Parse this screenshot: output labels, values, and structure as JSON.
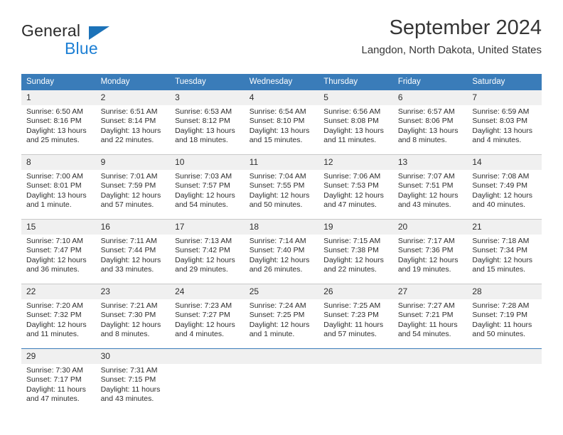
{
  "brand": {
    "name_dark": "General",
    "name_blue": "Blue",
    "triangle_color": "#1c72b8",
    "blue_color": "#1c7fd4"
  },
  "header": {
    "title": "September 2024",
    "location": "Langdon, North Dakota, United States"
  },
  "theme": {
    "header_bg": "#3a7cb9",
    "header_text": "#ffffff",
    "daynum_bg": "#f0f0f0",
    "grid_line": "#c9c9c9",
    "text": "#2d2d2d"
  },
  "weekdays": [
    "Sunday",
    "Monday",
    "Tuesday",
    "Wednesday",
    "Thursday",
    "Friday",
    "Saturday"
  ],
  "weeks": [
    [
      {
        "day": "1",
        "sunrise": "Sunrise: 6:50 AM",
        "sunset": "Sunset: 8:16 PM",
        "daylight1": "Daylight: 13 hours",
        "daylight2": "and 25 minutes."
      },
      {
        "day": "2",
        "sunrise": "Sunrise: 6:51 AM",
        "sunset": "Sunset: 8:14 PM",
        "daylight1": "Daylight: 13 hours",
        "daylight2": "and 22 minutes."
      },
      {
        "day": "3",
        "sunrise": "Sunrise: 6:53 AM",
        "sunset": "Sunset: 8:12 PM",
        "daylight1": "Daylight: 13 hours",
        "daylight2": "and 18 minutes."
      },
      {
        "day": "4",
        "sunrise": "Sunrise: 6:54 AM",
        "sunset": "Sunset: 8:10 PM",
        "daylight1": "Daylight: 13 hours",
        "daylight2": "and 15 minutes."
      },
      {
        "day": "5",
        "sunrise": "Sunrise: 6:56 AM",
        "sunset": "Sunset: 8:08 PM",
        "daylight1": "Daylight: 13 hours",
        "daylight2": "and 11 minutes."
      },
      {
        "day": "6",
        "sunrise": "Sunrise: 6:57 AM",
        "sunset": "Sunset: 8:06 PM",
        "daylight1": "Daylight: 13 hours",
        "daylight2": "and 8 minutes."
      },
      {
        "day": "7",
        "sunrise": "Sunrise: 6:59 AM",
        "sunset": "Sunset: 8:03 PM",
        "daylight1": "Daylight: 13 hours",
        "daylight2": "and 4 minutes."
      }
    ],
    [
      {
        "day": "8",
        "sunrise": "Sunrise: 7:00 AM",
        "sunset": "Sunset: 8:01 PM",
        "daylight1": "Daylight: 13 hours",
        "daylight2": "and 1 minute."
      },
      {
        "day": "9",
        "sunrise": "Sunrise: 7:01 AM",
        "sunset": "Sunset: 7:59 PM",
        "daylight1": "Daylight: 12 hours",
        "daylight2": "and 57 minutes."
      },
      {
        "day": "10",
        "sunrise": "Sunrise: 7:03 AM",
        "sunset": "Sunset: 7:57 PM",
        "daylight1": "Daylight: 12 hours",
        "daylight2": "and 54 minutes."
      },
      {
        "day": "11",
        "sunrise": "Sunrise: 7:04 AM",
        "sunset": "Sunset: 7:55 PM",
        "daylight1": "Daylight: 12 hours",
        "daylight2": "and 50 minutes."
      },
      {
        "day": "12",
        "sunrise": "Sunrise: 7:06 AM",
        "sunset": "Sunset: 7:53 PM",
        "daylight1": "Daylight: 12 hours",
        "daylight2": "and 47 minutes."
      },
      {
        "day": "13",
        "sunrise": "Sunrise: 7:07 AM",
        "sunset": "Sunset: 7:51 PM",
        "daylight1": "Daylight: 12 hours",
        "daylight2": "and 43 minutes."
      },
      {
        "day": "14",
        "sunrise": "Sunrise: 7:08 AM",
        "sunset": "Sunset: 7:49 PM",
        "daylight1": "Daylight: 12 hours",
        "daylight2": "and 40 minutes."
      }
    ],
    [
      {
        "day": "15",
        "sunrise": "Sunrise: 7:10 AM",
        "sunset": "Sunset: 7:47 PM",
        "daylight1": "Daylight: 12 hours",
        "daylight2": "and 36 minutes."
      },
      {
        "day": "16",
        "sunrise": "Sunrise: 7:11 AM",
        "sunset": "Sunset: 7:44 PM",
        "daylight1": "Daylight: 12 hours",
        "daylight2": "and 33 minutes."
      },
      {
        "day": "17",
        "sunrise": "Sunrise: 7:13 AM",
        "sunset": "Sunset: 7:42 PM",
        "daylight1": "Daylight: 12 hours",
        "daylight2": "and 29 minutes."
      },
      {
        "day": "18",
        "sunrise": "Sunrise: 7:14 AM",
        "sunset": "Sunset: 7:40 PM",
        "daylight1": "Daylight: 12 hours",
        "daylight2": "and 26 minutes."
      },
      {
        "day": "19",
        "sunrise": "Sunrise: 7:15 AM",
        "sunset": "Sunset: 7:38 PM",
        "daylight1": "Daylight: 12 hours",
        "daylight2": "and 22 minutes."
      },
      {
        "day": "20",
        "sunrise": "Sunrise: 7:17 AM",
        "sunset": "Sunset: 7:36 PM",
        "daylight1": "Daylight: 12 hours",
        "daylight2": "and 19 minutes."
      },
      {
        "day": "21",
        "sunrise": "Sunrise: 7:18 AM",
        "sunset": "Sunset: 7:34 PM",
        "daylight1": "Daylight: 12 hours",
        "daylight2": "and 15 minutes."
      }
    ],
    [
      {
        "day": "22",
        "sunrise": "Sunrise: 7:20 AM",
        "sunset": "Sunset: 7:32 PM",
        "daylight1": "Daylight: 12 hours",
        "daylight2": "and 11 minutes."
      },
      {
        "day": "23",
        "sunrise": "Sunrise: 7:21 AM",
        "sunset": "Sunset: 7:30 PM",
        "daylight1": "Daylight: 12 hours",
        "daylight2": "and 8 minutes."
      },
      {
        "day": "24",
        "sunrise": "Sunrise: 7:23 AM",
        "sunset": "Sunset: 7:27 PM",
        "daylight1": "Daylight: 12 hours",
        "daylight2": "and 4 minutes."
      },
      {
        "day": "25",
        "sunrise": "Sunrise: 7:24 AM",
        "sunset": "Sunset: 7:25 PM",
        "daylight1": "Daylight: 12 hours",
        "daylight2": "and 1 minute."
      },
      {
        "day": "26",
        "sunrise": "Sunrise: 7:25 AM",
        "sunset": "Sunset: 7:23 PM",
        "daylight1": "Daylight: 11 hours",
        "daylight2": "and 57 minutes."
      },
      {
        "day": "27",
        "sunrise": "Sunrise: 7:27 AM",
        "sunset": "Sunset: 7:21 PM",
        "daylight1": "Daylight: 11 hours",
        "daylight2": "and 54 minutes."
      },
      {
        "day": "28",
        "sunrise": "Sunrise: 7:28 AM",
        "sunset": "Sunset: 7:19 PM",
        "daylight1": "Daylight: 11 hours",
        "daylight2": "and 50 minutes."
      }
    ],
    [
      {
        "day": "29",
        "sunrise": "Sunrise: 7:30 AM",
        "sunset": "Sunset: 7:17 PM",
        "daylight1": "Daylight: 11 hours",
        "daylight2": "and 47 minutes."
      },
      {
        "day": "30",
        "sunrise": "Sunrise: 7:31 AM",
        "sunset": "Sunset: 7:15 PM",
        "daylight1": "Daylight: 11 hours",
        "daylight2": "and 43 minutes."
      },
      {
        "day": "",
        "sunrise": "",
        "sunset": "",
        "daylight1": "",
        "daylight2": ""
      },
      {
        "day": "",
        "sunrise": "",
        "sunset": "",
        "daylight1": "",
        "daylight2": ""
      },
      {
        "day": "",
        "sunrise": "",
        "sunset": "",
        "daylight1": "",
        "daylight2": ""
      },
      {
        "day": "",
        "sunrise": "",
        "sunset": "",
        "daylight1": "",
        "daylight2": ""
      },
      {
        "day": "",
        "sunrise": "",
        "sunset": "",
        "daylight1": "",
        "daylight2": ""
      }
    ]
  ]
}
